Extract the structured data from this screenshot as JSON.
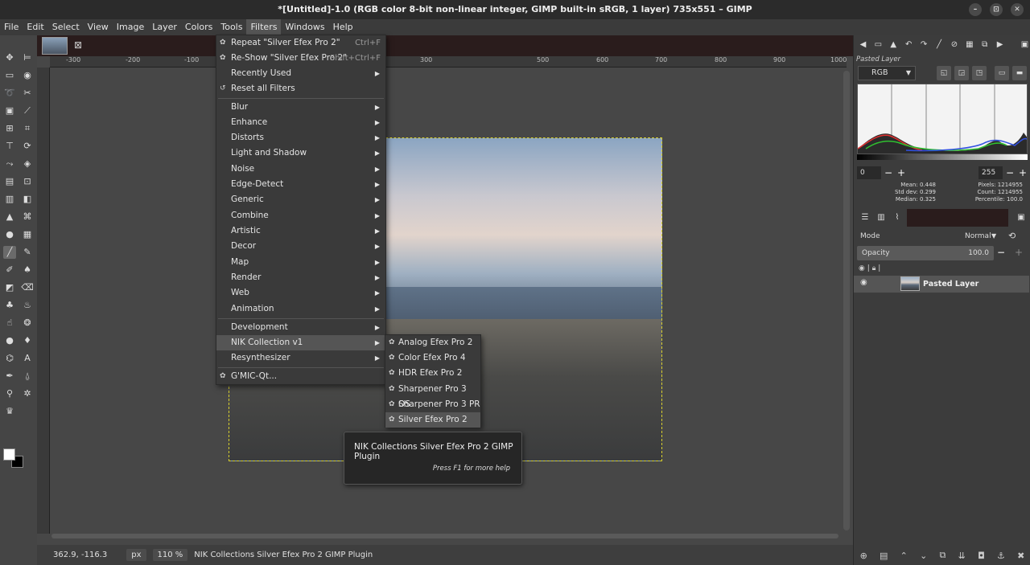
{
  "window": {
    "title": "*[Untitled]-1.0 (RGB color 8-bit non-linear integer, GIMP built-in sRGB, 1 layer) 735x551 – GIMP",
    "controls": [
      "–",
      "⊡",
      "✕"
    ]
  },
  "menubar": [
    "File",
    "Edit",
    "Select",
    "View",
    "Image",
    "Layer",
    "Colors",
    "Tools",
    "Filters",
    "Windows",
    "Help"
  ],
  "filters_menu": {
    "top_items": [
      {
        "label": "Repeat \"Silver Efex Pro 2\"",
        "shortcut": "Ctrl+F"
      },
      {
        "label": "Re-Show \"Silver Efex Pro 2\"",
        "shortcut": "Shift+Ctrl+F"
      },
      {
        "label": "Recently Used"
      },
      {
        "label": "Reset all Filters"
      }
    ],
    "groups": [
      "Blur",
      "Enhance",
      "Distorts",
      "Light and Shadow",
      "Noise",
      "Edge-Detect",
      "Generic",
      "Combine",
      "Artistic",
      "Decor",
      "Map",
      "Render",
      "Web",
      "Animation"
    ],
    "bottom": [
      "Development",
      "NIK Collection v1",
      "Resynthesizer"
    ],
    "gmic": "G'MIC-Qt..."
  },
  "nik_submenu": [
    "Analog Efex Pro 2",
    "Color Efex Pro 4",
    "HDR Efex Pro 2",
    "Sharpener Pro 3 OS",
    "Sharpener Pro 3 PR",
    "Silver Efex Pro 2"
  ],
  "tooltip": {
    "title": "NIK Collections Silver Efex Pro 2 GIMP Plugin",
    "help": "Press F1 for more help"
  },
  "ruler": {
    "labels": [
      "-300",
      "-200",
      "-100",
      "300",
      "500",
      "600",
      "700",
      "800",
      "900",
      "1000"
    ]
  },
  "statusbar": {
    "coords": "362.9, -116.3",
    "unit": "px",
    "zoom": "110 %",
    "message": "NIK Collections Silver Efex Pro 2 GIMP Plugin"
  },
  "dock": {
    "layer_label_top": "Pasted Layer",
    "histogram": {
      "channel": "RGB",
      "range_low": "0",
      "range_high": "255",
      "mean": "Mean: 0.448",
      "stddev": "Std dev: 0.299",
      "median": "Median: 0.325",
      "pixels": "Pixels: 1214955",
      "count": "Count: 1214955",
      "percentile": "Percentile: 100.0"
    },
    "layers": {
      "mode_label": "Mode",
      "mode_value": "Normal",
      "opacity_label": "Opacity",
      "opacity_value": "100.0",
      "layer_name": "Pasted Layer"
    }
  },
  "colors": {
    "selection_border": "#d8d030",
    "menu_bg": "#3a3a3a",
    "highlight": "#555555"
  }
}
